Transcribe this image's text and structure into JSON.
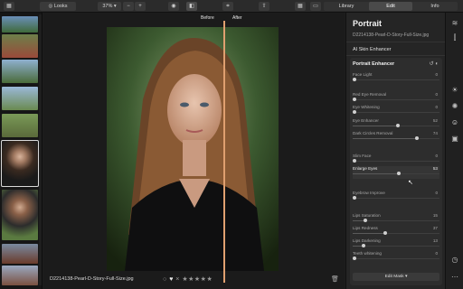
{
  "toolbar": {
    "looks_label": "Looks",
    "zoom_value": "37%",
    "zoom_minus": "−",
    "zoom_plus": "+",
    "modes": [
      {
        "label": "Library"
      },
      {
        "label": "Edit"
      },
      {
        "label": "Info"
      }
    ]
  },
  "viewer": {
    "before_label": "Before",
    "after_label": "After",
    "filename": "D2214138-Pearl-D-Story-Full-Size.jpg",
    "rating_stars": "★★★★★",
    "reject_mark": "×",
    "favorite_icon": "♥",
    "circle_icon": "○"
  },
  "panel": {
    "title": "Portrait",
    "subtitle": "D2214138-Pearl-D-Story-Full-Size.jpg",
    "ai_skin": "AI Skin Enhancer",
    "portrait_enhancer": "Portrait Enhancer",
    "edit_mask": "Edit Mask ▾",
    "sliders": [
      {
        "label": "Face Light",
        "value": "0",
        "level": 0.0
      },
      {
        "label": "Red Eye Removal",
        "value": "0",
        "level": 0.0
      },
      {
        "label": "Eye Whitening",
        "value": "0",
        "level": 0.0
      },
      {
        "label": "Eye Enhancer",
        "value": "52",
        "level": 0.52
      },
      {
        "label": "Dark Circles Removal",
        "value": "74",
        "level": 0.74
      },
      {
        "label": "Slim Face",
        "value": "0",
        "level": 0.0
      },
      {
        "label": "Enlarge Eyes",
        "value": "53",
        "level": 0.53
      },
      {
        "label": "Eyebrow Improve",
        "value": "0",
        "level": 0.0
      },
      {
        "label": "Lips Saturation",
        "value": "15",
        "level": 0.15
      },
      {
        "label": "Lips Redness",
        "value": "37",
        "level": 0.37
      },
      {
        "label": "Lips Darkening",
        "value": "13",
        "level": 0.13
      },
      {
        "label": "Teeth whitening",
        "value": "0",
        "level": 0.0
      }
    ]
  },
  "colors": {
    "accent": "#e0a070",
    "panel_bg": "#252525",
    "viewer_bg": "#1b1b1b"
  }
}
